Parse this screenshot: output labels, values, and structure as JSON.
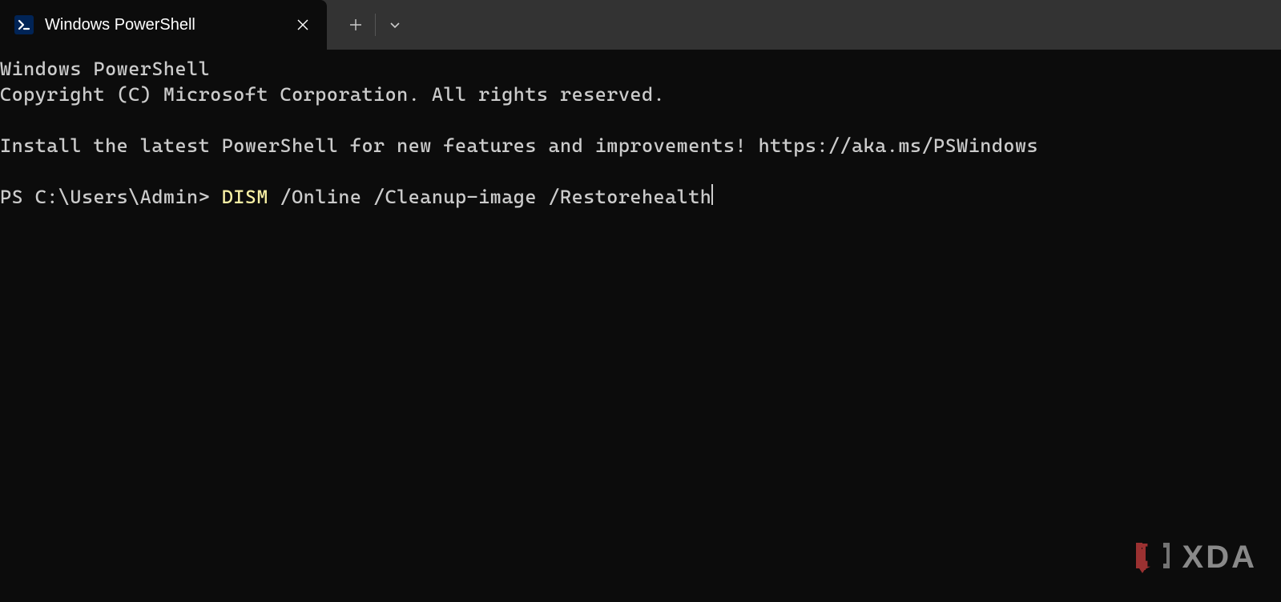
{
  "tab": {
    "title": "Windows PowerShell"
  },
  "terminal": {
    "banner_line1": "Windows PowerShell",
    "banner_line2": "Copyright (C) Microsoft Corporation. All rights reserved.",
    "install_msg": "Install the latest PowerShell for new features and improvements! https://aka.ms/PSWindows",
    "prompt": "PS C:\\Users\\Admin> ",
    "command_name": "DISM",
    "command_args": " /Online /Cleanup-image /Restorehealth"
  },
  "watermark": {
    "text": "XDA"
  }
}
